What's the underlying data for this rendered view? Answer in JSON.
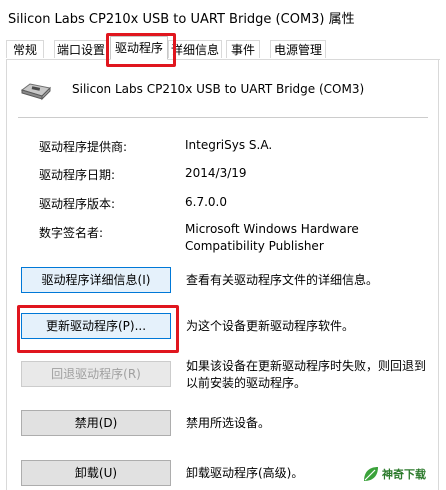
{
  "window": {
    "title": "Silicon Labs CP210x USB to UART Bridge (COM3) 属性"
  },
  "tabs": [
    {
      "label": "常规",
      "active": false
    },
    {
      "label": "端口设置",
      "active": false
    },
    {
      "label": "驱动程序",
      "active": true
    },
    {
      "label": "详细信息",
      "active": false
    },
    {
      "label": "事件",
      "active": false
    },
    {
      "label": "电源管理",
      "active": false
    }
  ],
  "device": {
    "name": "Silicon Labs CP210x USB to UART Bridge (COM3)",
    "icon": "usb-serial-device-icon"
  },
  "info": [
    {
      "label": "驱动程序提供商:",
      "value": "IntegriSys S.A."
    },
    {
      "label": "驱动程序日期:",
      "value": "2014/3/19"
    },
    {
      "label": "驱动程序版本:",
      "value": "6.7.0.0"
    },
    {
      "label": "数字签名者:",
      "value_line1": "Microsoft Windows Hardware",
      "value_line2": "Compatibility Publisher"
    }
  ],
  "actions": [
    {
      "button": "驱动程序详细信息(I)",
      "desc": "查看有关驱动程序文件的详细信息。"
    },
    {
      "button": "更新驱动程序(P)...",
      "desc": "为这个设备更新驱动程序软件。"
    },
    {
      "button": "回退驱动程序(R)",
      "desc_line1": "如果该设备在更新驱动程序时失败，则回退到",
      "desc_line2": "以前安装的驱动程序。"
    },
    {
      "button": "禁用(D)",
      "desc": "禁用所选设备。"
    },
    {
      "button": "卸载(U)",
      "desc": "卸载驱动程序(高级)。"
    }
  ],
  "watermark": {
    "text": "神奇下载"
  },
  "colors": {
    "highlight": "#e0161e",
    "focus_border": "#0078d7"
  }
}
